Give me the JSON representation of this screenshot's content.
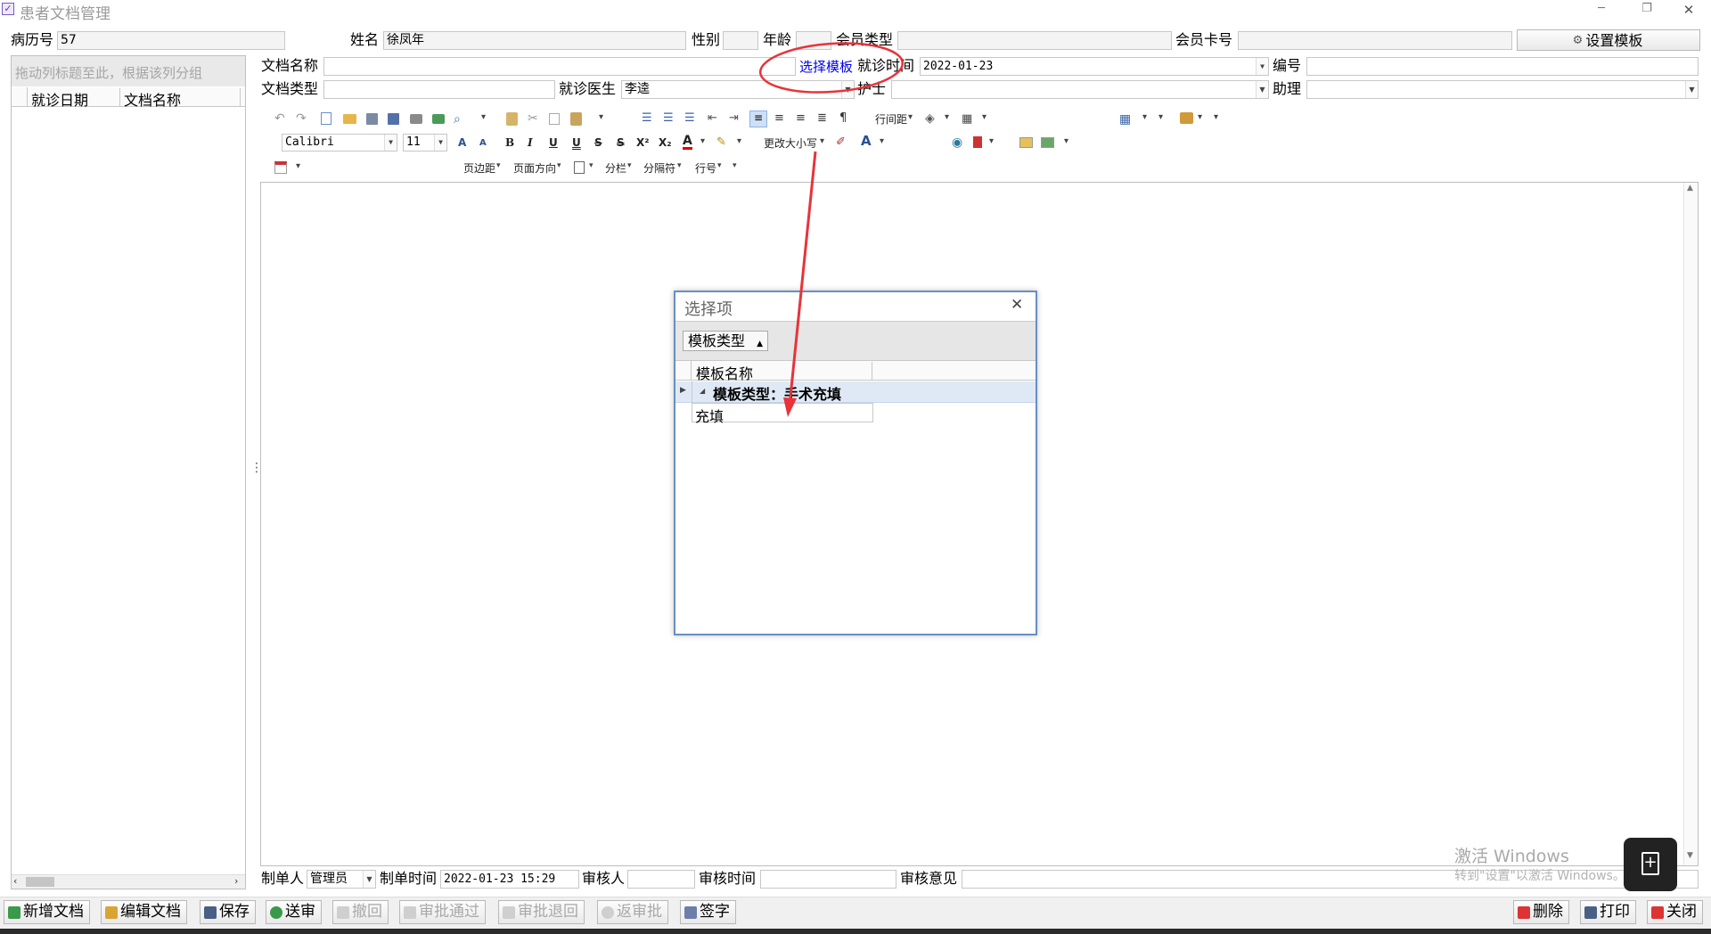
{
  "window": {
    "title": "患者文档管理",
    "minimize": "─",
    "restore": "❐",
    "close": "✕"
  },
  "patient": {
    "record_no_label": "病历号",
    "record_no": "57",
    "name_label": "姓名",
    "name": "徐凤年",
    "gender_label": "性别",
    "gender": "",
    "age_label": "年龄",
    "age": "",
    "member_type_label": "会员类型",
    "member_type": "",
    "member_card_label": "会员卡号",
    "member_card": "",
    "template_settings_button": "设置模板"
  },
  "left_panel": {
    "group_hint": "拖动列标题至此，根据该列分组",
    "col_visit_date": "就诊日期",
    "col_doc_name": "文档名称"
  },
  "doc_form": {
    "doc_name_label": "文档名称",
    "doc_name": "",
    "select_template_link": "选择模板",
    "visit_time_label": "就诊时间",
    "visit_time": "2022-01-23",
    "serial_label": "编号",
    "serial": "",
    "doc_type_label": "文档类型",
    "doc_type": "",
    "doctor_label": "就诊医生",
    "doctor": "李逵",
    "nurse_label": "护士",
    "nurse": "",
    "assistant_label": "助理",
    "assistant": ""
  },
  "toolbar": {
    "font_name": "Calibri",
    "font_size": "11",
    "line_spacing": "行间距",
    "change_case": "更改大小写",
    "page_margin": "页边距",
    "page_orientation": "页面方向",
    "columns": "分栏",
    "separator": "分隔符",
    "line_number": "行号",
    "bold": "B",
    "italic": "I",
    "underline": "U",
    "double_underline": "U",
    "strike": "S",
    "double_strike": "S",
    "superscript": "X²",
    "subscript": "X₂",
    "font_color": "A",
    "grow_font": "A",
    "shrink_font": "A",
    "big_a": "A"
  },
  "dialog": {
    "title": "选择项",
    "group_by_chip": "模板类型",
    "col_template_name": "模板名称",
    "group_row": "模板类型：手术充填",
    "rows": [
      "充填"
    ]
  },
  "footer_form": {
    "creator_label": "制单人",
    "creator": "管理员",
    "create_time_label": "制单时间",
    "create_time": "2022-01-23 15:29",
    "reviewer_label": "审核人",
    "reviewer": "",
    "review_time_label": "审核时间",
    "review_time": "",
    "review_opinion_label": "审核意见",
    "review_opinion": ""
  },
  "watermark": {
    "line1": "激活 Windows",
    "line2": "转到\"设置\"以激活 Windows。"
  },
  "buttons": {
    "new_doc": "新增文档",
    "edit_doc": "编辑文档",
    "save": "保存",
    "submit": "送审",
    "withdraw": "撤回",
    "approve": "审批通过",
    "reject": "审批退回",
    "unapprove": "返审批",
    "sign": "签字",
    "delete": "删除",
    "print": "打印",
    "close": "关闭"
  },
  "colors": {
    "annotation_red": "#e8333a",
    "link_blue": "#0000ee",
    "dialog_border": "#6a8fbf"
  }
}
